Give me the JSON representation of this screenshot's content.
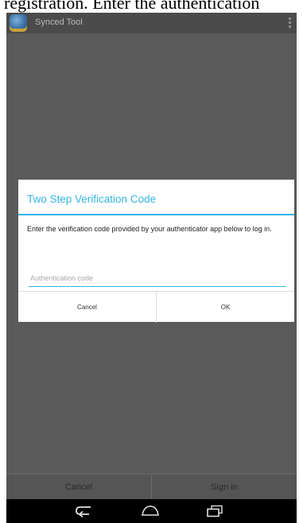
{
  "caption": {
    "text": "registration. Enter the authentication"
  },
  "action_bar": {
    "title": "Synced Tool",
    "app_icon": "app-icon",
    "menu_icon": "overflow-menu-icon"
  },
  "dialog": {
    "title": "Two Step Verification Code",
    "message": "Enter the verification code provided by your authenticator app below to log in.",
    "input": {
      "placeholder": "Authentication code",
      "value": ""
    },
    "cancel_label": "Cancel",
    "ok_label": "OK"
  },
  "bottom_bar": {
    "cancel_label": "Cancel",
    "sign_in_label": "Sign in"
  },
  "nav_bar": {
    "icons": [
      "back-icon",
      "home-icon",
      "recents-icon"
    ]
  },
  "colors": {
    "accent": "#33b5e5",
    "dim_background": "#5a5a5a",
    "action_bar": "#4b4b4b",
    "nav_bar": "#000000"
  }
}
